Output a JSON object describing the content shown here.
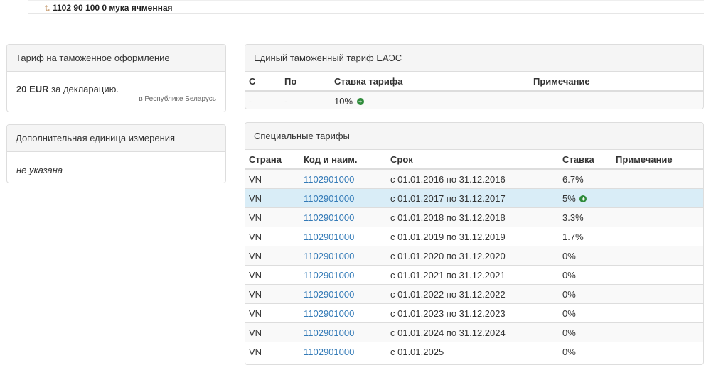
{
  "header": {
    "letter": "t.",
    "title": "1102 90 100 0 мука ячменная"
  },
  "tariff_panel": {
    "heading": "Тариф на таможенное оформление",
    "amount": "20 EUR",
    "suffix": " за декларацию.",
    "note": "в Республике Беларусь"
  },
  "unit_panel": {
    "heading": "Дополнительная единица измерения",
    "value": "не указана"
  },
  "eaes_panel": {
    "heading": "Единый таможенный тариф ЕАЭС",
    "columns": [
      "С",
      "По",
      "Ставка тарифа",
      "Примечание"
    ],
    "row": {
      "from": "-",
      "to": "-",
      "rate": "10%",
      "note": ""
    }
  },
  "special_panel": {
    "heading": "Специальные тарифы",
    "columns": [
      "Страна",
      "Код и наим.",
      "Срок",
      "Ставка",
      "Примечание"
    ],
    "rows": [
      {
        "country": "VN",
        "code": "1102901000",
        "period": "с 01.01.2016 по 31.12.2016",
        "rate": "6.7%"
      },
      {
        "country": "VN",
        "code": "1102901000",
        "period": "с 01.01.2017 по 31.12.2017",
        "rate": "5%"
      },
      {
        "country": "VN",
        "code": "1102901000",
        "period": "с 01.01.2018 по 31.12.2018",
        "rate": "3.3%"
      },
      {
        "country": "VN",
        "code": "1102901000",
        "period": "с 01.01.2019 по 31.12.2019",
        "rate": "1.7%"
      },
      {
        "country": "VN",
        "code": "1102901000",
        "period": "с 01.01.2020 по 31.12.2020",
        "rate": "0%"
      },
      {
        "country": "VN",
        "code": "1102901000",
        "period": "с 01.01.2021 по 31.12.2021",
        "rate": "0%"
      },
      {
        "country": "VN",
        "code": "1102901000",
        "period": "с 01.01.2022 по 31.12.2022",
        "rate": "0%"
      },
      {
        "country": "VN",
        "code": "1102901000",
        "period": "с 01.01.2023 по 31.12.2023",
        "rate": "0%"
      },
      {
        "country": "VN",
        "code": "1102901000",
        "period": "с 01.01.2024 по 31.12.2024",
        "rate": "0%"
      },
      {
        "country": "VN",
        "code": "1102901000",
        "period": "с 01.01.2025",
        "rate": "0%"
      }
    ]
  },
  "colors": {
    "link": "#337ab7",
    "highlight": "#d9edf7",
    "plus_icon": "#2e8b3a"
  },
  "icons": {
    "plus": "circle-plus-icon"
  }
}
